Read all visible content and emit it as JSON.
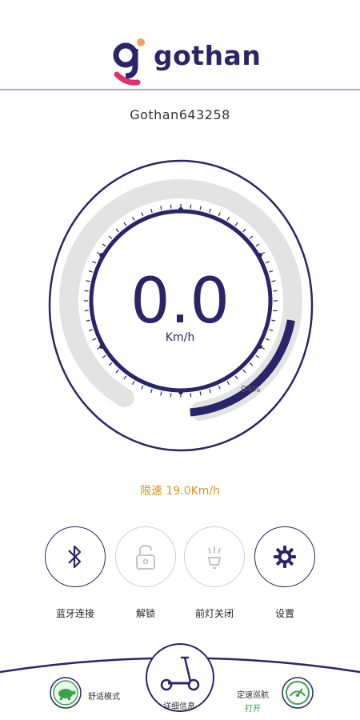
{
  "header": {
    "brand": "gothan"
  },
  "device": {
    "name": "Gothan643258"
  },
  "speedometer": {
    "speed": "0.0",
    "unit": "Km/h",
    "battery_percent_label": "94%",
    "battery_level": 0.94
  },
  "speed_limit": {
    "label": "限速 19.0Km/h"
  },
  "controls": [
    {
      "label": "蓝牙连接",
      "icon": "bluetooth-icon"
    },
    {
      "label": "解锁",
      "icon": "unlock-icon"
    },
    {
      "label": "前灯关闭",
      "icon": "headlight-icon"
    },
    {
      "label": "设置",
      "icon": "gear-icon"
    }
  ],
  "bottom_bar": {
    "mode_label": "舒适模式",
    "detail_label": "详细信息",
    "cruise_label": "定速巡航",
    "cruise_status": "打开"
  },
  "colors": {
    "primary": "#2a2468",
    "accent": "#d9941e",
    "logo_pink": "#e0306f",
    "logo_orange": "#f3a35a",
    "on_green": "#27a844"
  }
}
